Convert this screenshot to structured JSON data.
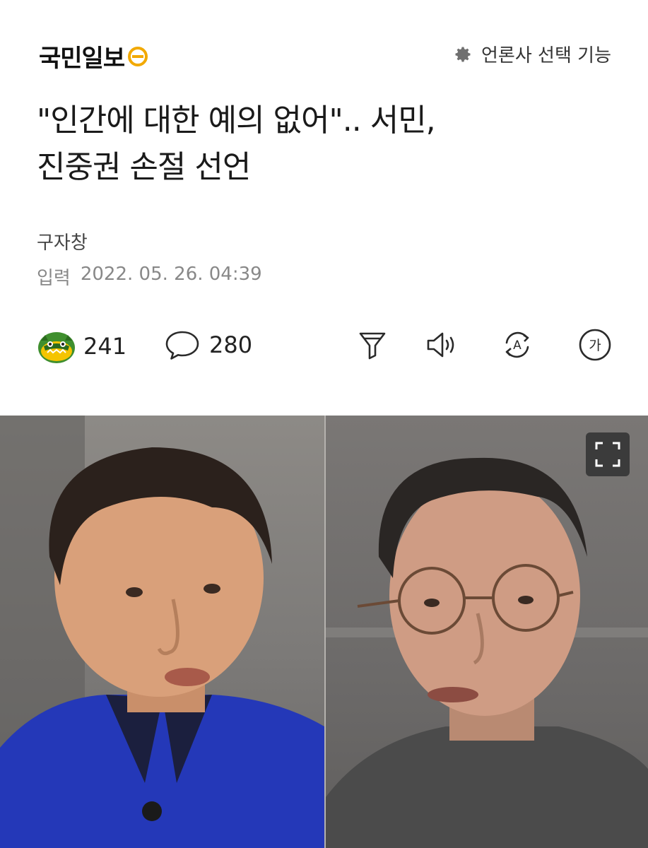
{
  "header": {
    "logo_text": "국민일보",
    "press_select_label": "언론사 선택 기능"
  },
  "article": {
    "title_line1": "\"인간에 대한 예의 없어\".. 서민,",
    "title_line2": "진중권 손절 선언",
    "author": "구자창",
    "date_label": "입력",
    "date_value": "2022. 05. 26. 04:39"
  },
  "actions": {
    "reaction_count": "241",
    "comment_count": "280",
    "tools": [
      "summary-icon",
      "speaker-icon",
      "translate-icon",
      "font-size-icon"
    ],
    "font_size_glyph": "가",
    "translate_glyph": "A"
  },
  "colors": {
    "logo_accent": "#f2a900",
    "reaction_green": "#3f8f2e",
    "reaction_yellow": "#f5c400"
  }
}
